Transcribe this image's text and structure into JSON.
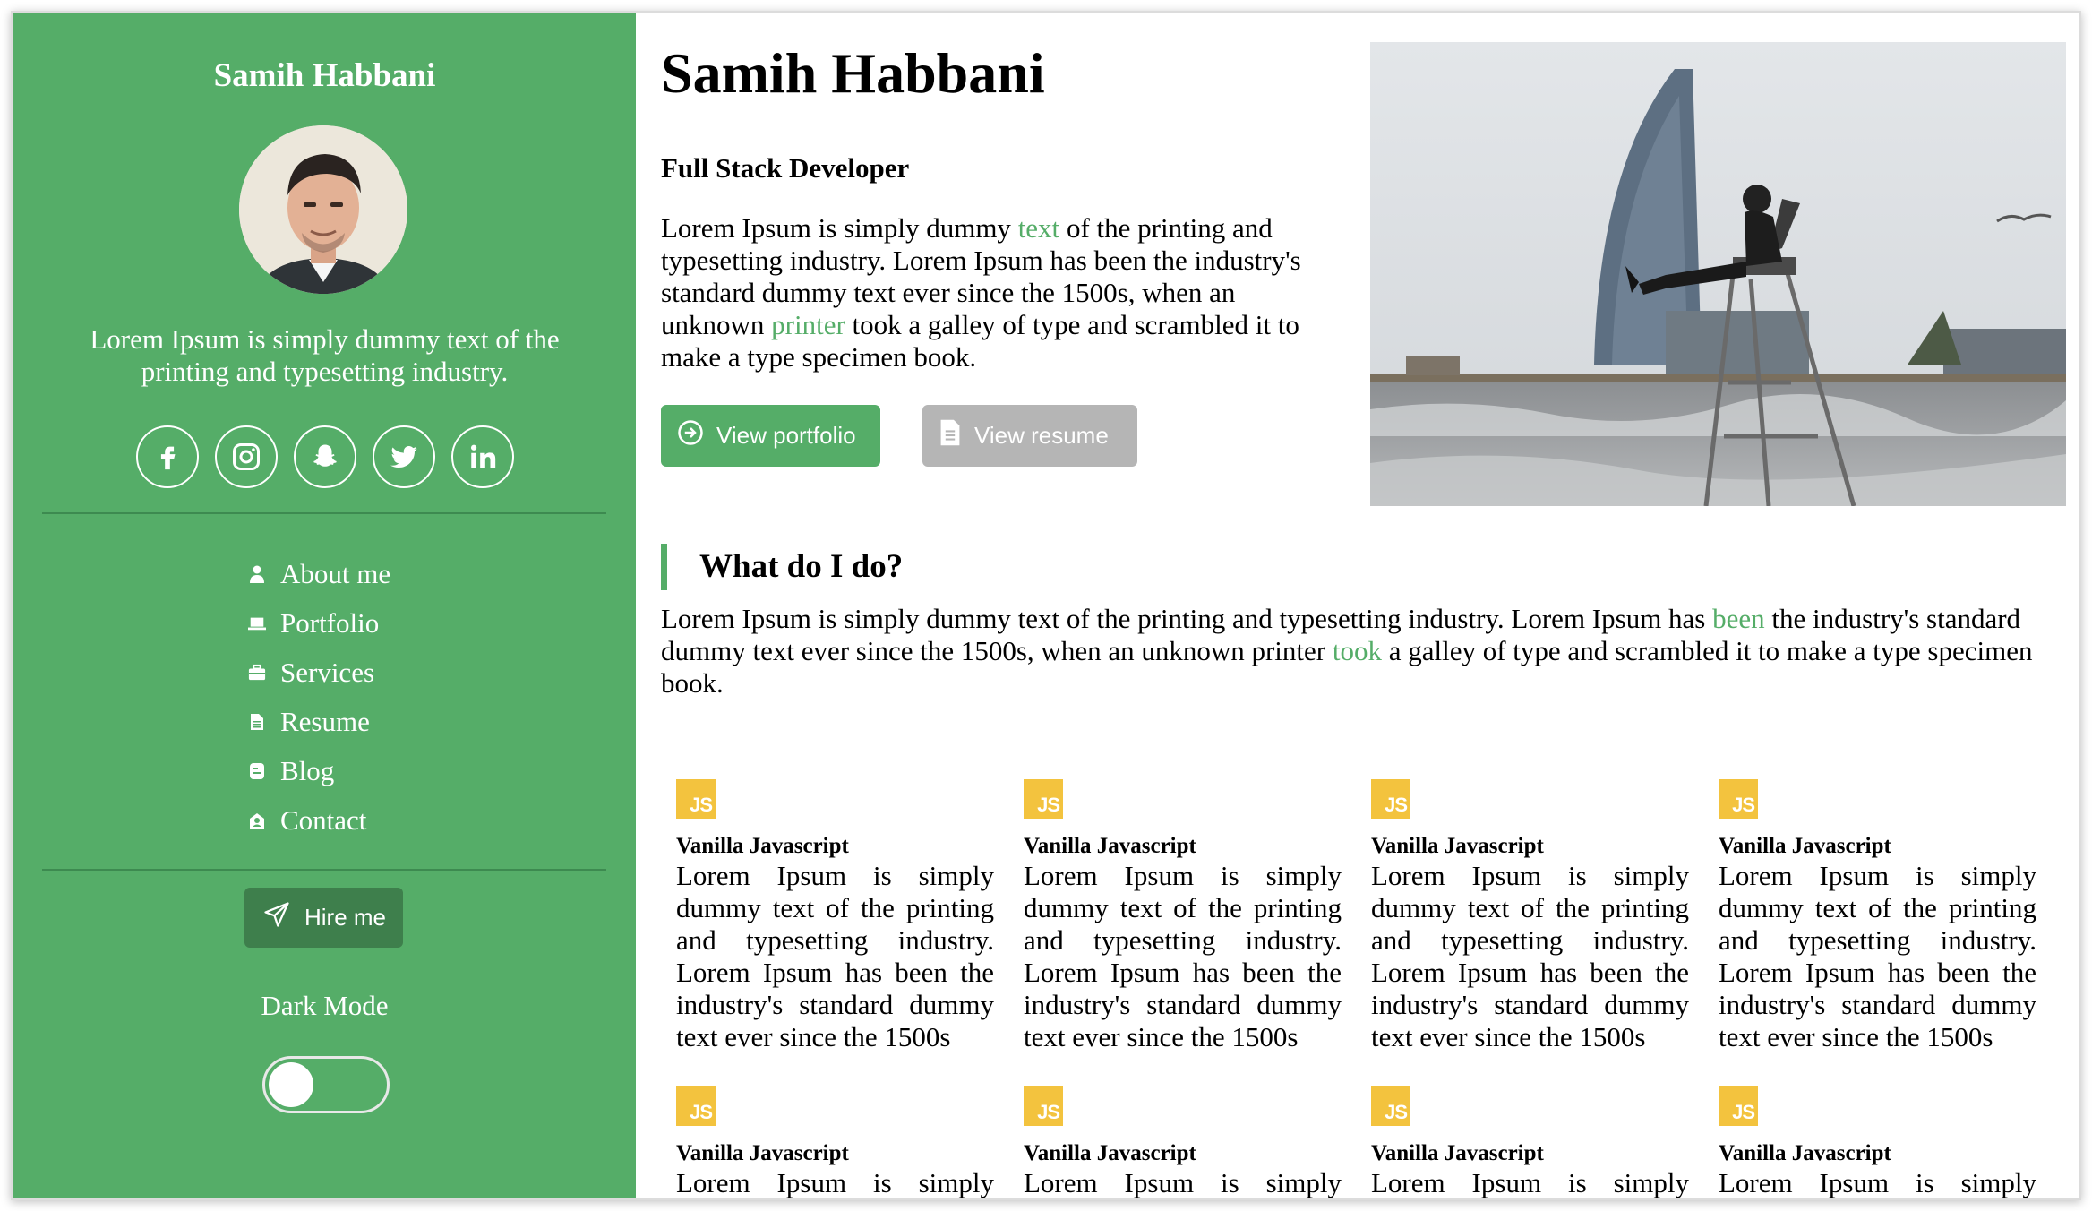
{
  "sidebar": {
    "name": "Samih Habbani",
    "tagline": "Lorem Ipsum is simply dummy text of the printing and typesetting industry.",
    "socials": [
      "facebook-icon",
      "instagram-icon",
      "snapchat-icon",
      "twitter-icon",
      "linkedin-icon"
    ],
    "nav": [
      {
        "label": "About me",
        "icon": "user-icon"
      },
      {
        "label": "Portfolio",
        "icon": "laptop-icon"
      },
      {
        "label": "Services",
        "icon": "briefcase-icon"
      },
      {
        "label": "Resume",
        "icon": "file-icon"
      },
      {
        "label": "Blog",
        "icon": "blog-icon"
      },
      {
        "label": "Contact",
        "icon": "contact-icon"
      }
    ],
    "hire_label": "Hire me",
    "dark_mode_label": "Dark Mode",
    "dark_mode_on": false
  },
  "main": {
    "title": "Samih Habbani",
    "role": "Full Stack Developer",
    "intro_parts": [
      "Lorem Ipsum is simply dummy ",
      "text",
      " of the printing and typesetting industry. Lorem Ipsum has been the industry's standard dummy text ever since the 1500s, when an unknown ",
      "printer",
      " took a galley of type and scrambled it to make a type specimen book."
    ],
    "view_portfolio_label": "View portfolio",
    "view_resume_label": "View resume",
    "section_title": "What do I do?",
    "section_parts": [
      "Lorem Ipsum is simply dummy text of the printing and typesetting industry. Lorem Ipsum has ",
      "been",
      " the industry's standard dummy text ever since the 1500s, when an unknown printer ",
      "took",
      " a galley of type and scrambled it to make a type specimen book."
    ],
    "cards": [
      {
        "badge": "JS",
        "title": "Vanilla Javascript",
        "text": "Lorem Ipsum is simply dummy text of the printing and typesetting industry. Lorem Ipsum has been the industry's standard dummy text ever since the 1500s"
      },
      {
        "badge": "JS",
        "title": "Vanilla Javascript",
        "text": "Lorem Ipsum is simply dummy text of the printing and typesetting industry. Lorem Ipsum has been the industry's standard dummy text ever since the 1500s"
      },
      {
        "badge": "JS",
        "title": "Vanilla Javascript",
        "text": "Lorem Ipsum is simply dummy text of the printing and typesetting industry. Lorem Ipsum has been the industry's standard dummy text ever since the 1500s"
      },
      {
        "badge": "JS",
        "title": "Vanilla Javascript",
        "text": "Lorem Ipsum is simply dummy text of the printing and typesetting industry. Lorem Ipsum has been the industry's standard dummy text ever since the 1500s"
      },
      {
        "badge": "JS",
        "title": "Vanilla Javascript",
        "text": "Lorem Ipsum is simply"
      },
      {
        "badge": "JS",
        "title": "Vanilla Javascript",
        "text": "Lorem Ipsum is simply"
      },
      {
        "badge": "JS",
        "title": "Vanilla Javascript",
        "text": "Lorem Ipsum is simply"
      },
      {
        "badge": "JS",
        "title": "Vanilla Javascript",
        "text": "Lorem Ipsum is simply"
      }
    ]
  },
  "colors": {
    "accent": "#55ad68",
    "hire_button": "#3e7f4c",
    "resume_button": "#b5b5b5",
    "js_badge": "#f3c33e"
  }
}
